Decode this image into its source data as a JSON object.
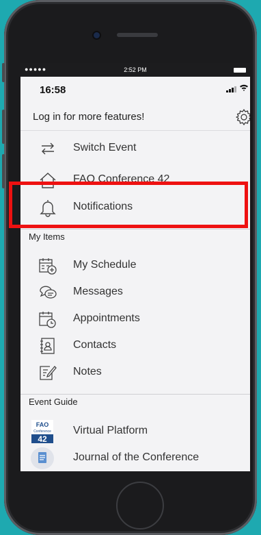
{
  "device_status": {
    "time": "2:52 PM"
  },
  "app_status": {
    "time": "16:58"
  },
  "login": {
    "label": "Log in for more features!",
    "settings_icon": "gear-icon"
  },
  "menu": [
    {
      "label": "Switch Event",
      "icon": "swap-arrows-icon"
    },
    {
      "label": "FAO Conference 42",
      "icon": "home-icon"
    },
    {
      "label": "Notifications",
      "icon": "bell-icon"
    }
  ],
  "sections": {
    "my_items": {
      "title": "My Items",
      "items": [
        {
          "label": "My Schedule",
          "icon": "calendar-add-icon"
        },
        {
          "label": "Messages",
          "icon": "chat-bubbles-icon"
        },
        {
          "label": "Appointments",
          "icon": "calendar-clock-icon"
        },
        {
          "label": "Contacts",
          "icon": "address-book-icon"
        },
        {
          "label": "Notes",
          "icon": "note-edit-icon"
        }
      ]
    },
    "event_guide": {
      "title": "Event Guide",
      "items": [
        {
          "label": "Virtual Platform",
          "icon": "fao-42-logo-icon",
          "logo_text_top": "FAO",
          "logo_text_mid": "Conference",
          "logo_text_num": "42"
        },
        {
          "label": "Journal of the Conference",
          "icon": "document-icon"
        }
      ]
    }
  },
  "colors": {
    "background": "#1ea9b0",
    "highlight": "#ee1111",
    "fao_blue": "#1f4e8c"
  }
}
